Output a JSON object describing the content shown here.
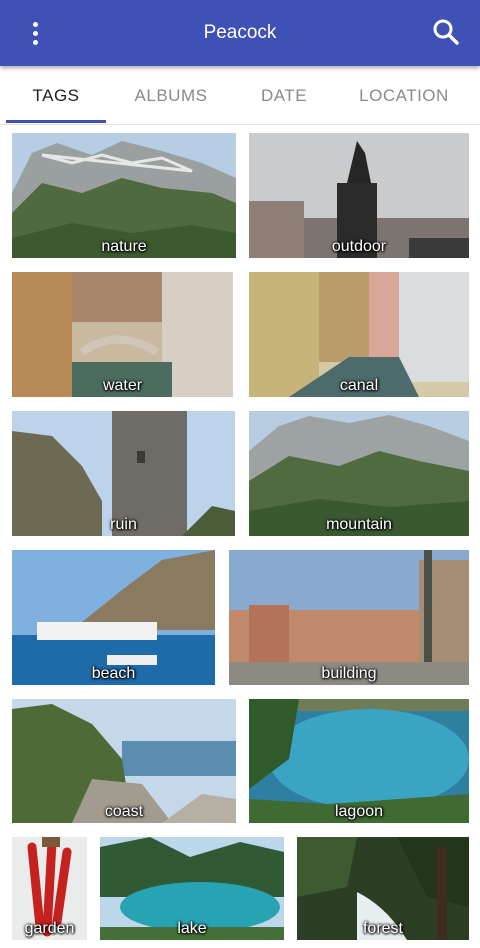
{
  "appbar": {
    "title": "Peacock",
    "menu_icon": "more-vert-icon",
    "search_icon": "search-icon"
  },
  "tabs": [
    {
      "label": "TAGS",
      "active": true
    },
    {
      "label": "ALBUMS",
      "active": false
    },
    {
      "label": "DATE",
      "active": false
    },
    {
      "label": "LOCATION",
      "active": false
    }
  ],
  "colors": {
    "primary": "#3f51b5",
    "tab_active": "#222222",
    "tab_inactive": "#8a8a8a"
  },
  "tags": [
    {
      "label": "nature"
    },
    {
      "label": "outdoor"
    },
    {
      "label": "water"
    },
    {
      "label": "canal"
    },
    {
      "label": "ruin"
    },
    {
      "label": "mountain"
    },
    {
      "label": "beach"
    },
    {
      "label": "building"
    },
    {
      "label": "coast"
    },
    {
      "label": "lagoon"
    },
    {
      "label": "garden"
    },
    {
      "label": "lake"
    },
    {
      "label": "forest"
    }
  ]
}
